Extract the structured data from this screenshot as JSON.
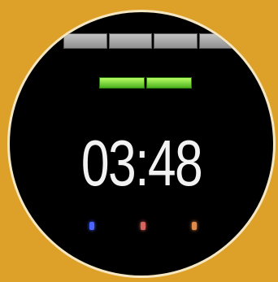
{
  "screen": {
    "tabs": [
      "",
      "",
      "",
      ""
    ],
    "action_buttons": [
      "",
      ""
    ],
    "time": "03:48",
    "indicator_colors": [
      "#4b63ff",
      "#d7655e",
      "#e08a4b"
    ]
  },
  "colors": {
    "background": "#dda12a",
    "bezel": "#f6e7c3",
    "face": "#000000",
    "tab": "#b5b5b5",
    "button": "#7de339",
    "time_text": "#f2f2f2"
  }
}
